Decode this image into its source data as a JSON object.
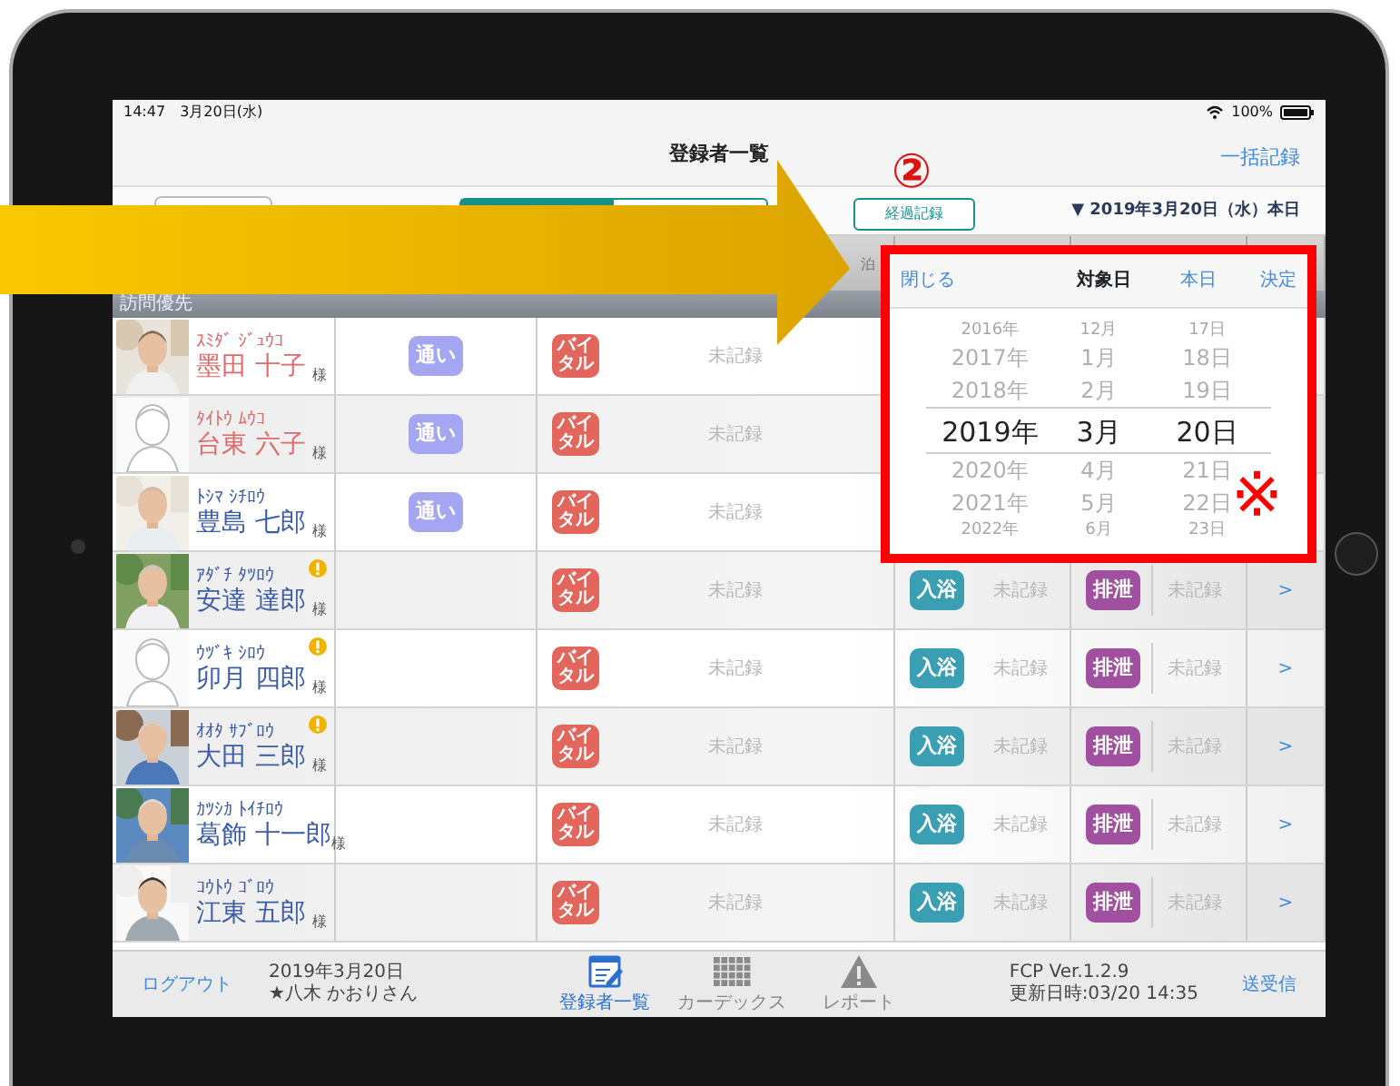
{
  "status_bar": {
    "time": "14:47",
    "date": "3月20日(水)",
    "battery": "100%"
  },
  "nav": {
    "title": "登録者一覧",
    "action": "一括記録"
  },
  "toolbar": {
    "progress_button": "経過記録",
    "date": "▼ 2019年3月20日（水）本日"
  },
  "table_header": {
    "fragment": "泊"
  },
  "section": "訪問優先",
  "residents": [
    {
      "kana": "ｽﾐﾀﾞ ｼﾞｭｳｺ",
      "name": "墨田 十子",
      "honorific": "様",
      "color": "#e06a6a",
      "alert": false,
      "service": "通い",
      "vital": "バイタル",
      "vital_status": "未記録"
    },
    {
      "kana": "ﾀｲﾄｳ ﾑｳｺ",
      "name": "台東 六子",
      "honorific": "様",
      "color": "#e06a6a",
      "avatar": {
        "kind": "drawing"
      },
      "alert": false,
      "service": "通い",
      "vital": "バイタル",
      "vital_status": "未記録"
    },
    {
      "kana": "ﾄｼﾏ ｼﾁﾛｳ",
      "name": "豊島 七郎",
      "honorific": "様",
      "color": "#3b5ca8",
      "alert": false,
      "service": "通い",
      "vital": "バイタル",
      "vital_status": "未記録"
    },
    {
      "kana": "ｱﾀﾞﾁ ﾀﾂﾛｳ",
      "name": "安達 達郎",
      "honorific": "様",
      "color": "#3b5ca8",
      "alert": true,
      "vital": "バイタル",
      "vital_status": "未記録",
      "bath": "入浴",
      "bath_status": "未記録",
      "excretion": "排泄",
      "excretion_status": "未記録",
      "more": ">"
    },
    {
      "kana": "ｳﾂﾞｷ ｼﾛｳ",
      "name": "卯月 四郎",
      "honorific": "様",
      "color": "#3b5ca8",
      "avatar": {
        "kind": "drawing"
      },
      "alert": true,
      "vital": "バイタル",
      "vital_status": "未記録",
      "bath": "入浴",
      "bath_status": "未記録",
      "excretion": "排泄",
      "excretion_status": "未記録",
      "more": ">"
    },
    {
      "kana": "ｵｵﾀ ｻﾌﾞﾛｳ",
      "name": "大田 三郎",
      "honorific": "様",
      "color": "#3b5ca8",
      "alert": true,
      "vital": "バイタル",
      "vital_status": "未記録",
      "bath": "入浴",
      "bath_status": "未記録",
      "excretion": "排泄",
      "excretion_status": "未記録",
      "more": ">"
    },
    {
      "kana": "ｶﾂｼｶ ﾄｲﾁﾛｳ",
      "name": "葛飾 十一郎",
      "honorific": "様",
      "color": "#3b5ca8",
      "alert": false,
      "vital": "バイタル",
      "vital_status": "未記録",
      "bath": "入浴",
      "bath_status": "未記録",
      "excretion": "排泄",
      "excretion_status": "未記録",
      "more": ">"
    },
    {
      "kana": "ｺｳﾄｳ ｺﾞﾛｳ",
      "name": "江東 五郎",
      "honorific": "様",
      "color": "#3b5ca8",
      "alert": false,
      "vital": "バイタル",
      "vital_status": "未記録",
      "bath": "入浴",
      "bath_status": "未記録",
      "excretion": "排泄",
      "excretion_status": "未記録",
      "more": ">"
    }
  ],
  "date_picker": {
    "close": "閉じる",
    "title": "対象日",
    "today": "本日",
    "done": "決定",
    "columns": [
      {
        "items": [
          {
            "text": "2016年",
            "selected": false
          },
          {
            "text": "2017年",
            "selected": false
          },
          {
            "text": "2018年",
            "selected": false
          },
          {
            "text": "2019年",
            "selected": true
          },
          {
            "text": "2020年",
            "selected": false
          },
          {
            "text": "2021年",
            "selected": false
          },
          {
            "text": "2022年",
            "selected": false
          }
        ]
      },
      {
        "items": [
          {
            "text": "12月",
            "selected": false
          },
          {
            "text": "1月",
            "selected": false
          },
          {
            "text": "2月",
            "selected": false
          },
          {
            "text": "3月",
            "selected": true
          },
          {
            "text": "4月",
            "selected": false
          },
          {
            "text": "5月",
            "selected": false
          },
          {
            "text": "6月",
            "selected": false
          }
        ]
      },
      {
        "items": [
          {
            "text": "17日",
            "selected": false
          },
          {
            "text": "18日",
            "selected": false
          },
          {
            "text": "19日",
            "selected": false
          },
          {
            "text": "20日",
            "selected": true
          },
          {
            "text": "21日",
            "selected": false
          },
          {
            "text": "22日",
            "selected": false
          },
          {
            "text": "23日",
            "selected": false
          }
        ]
      }
    ]
  },
  "annotations": {
    "step": "②",
    "mark": "※"
  },
  "footer": {
    "logout": "ログアウト",
    "date": "2019年3月20日",
    "user": "★八木 かおりさん",
    "tabs": [
      {
        "label": "登録者一覧",
        "selected": true
      },
      {
        "label": "カーデックス",
        "selected": false
      },
      {
        "label": "レポート",
        "selected": false
      }
    ],
    "version": "FCP Ver.1.2.9",
    "updated": "更新日時:03/20 14:35",
    "sync": "送受信"
  }
}
